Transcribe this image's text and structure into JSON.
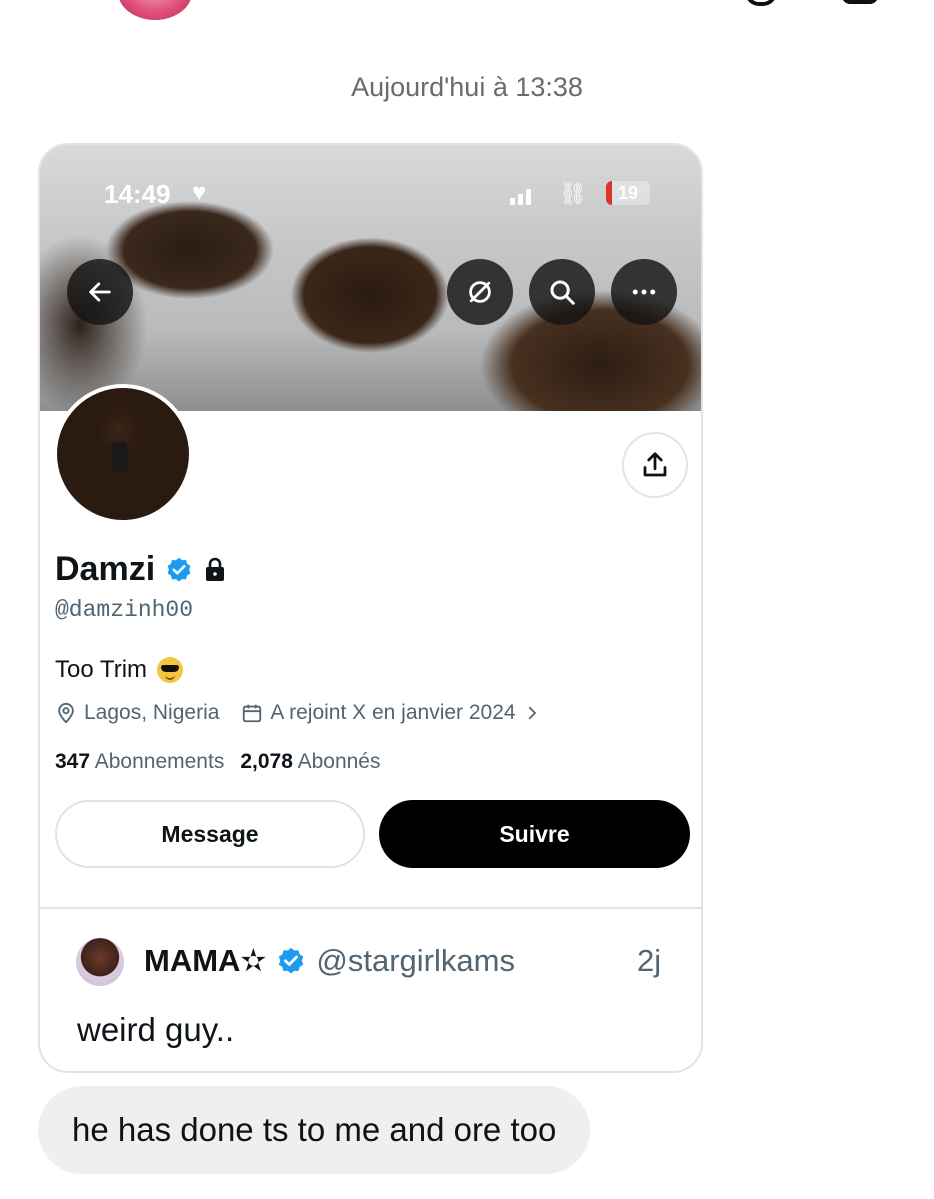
{
  "chat": {
    "timestamp": "Aujourd'hui à 13:38",
    "message_bubble": "he has done ts to me and ore too"
  },
  "profile_card": {
    "status_bar": {
      "time": "14:49",
      "battery": "19"
    },
    "name": "Damzi",
    "handle": "@damzinh00",
    "bio": "Too Trim",
    "location": "Lagos, Nigeria",
    "joined": "A rejoint X en janvier 2024",
    "following_count": "347",
    "following_label": "Abonnements",
    "followers_count": "2,078",
    "followers_label": "Abonnés",
    "message_button": "Message",
    "follow_button": "Suivre"
  },
  "quoted_post": {
    "author_name": "MAMA✫",
    "author_handle": "@stargirlkams",
    "time": "2j",
    "text": "weird guy.."
  },
  "colors": {
    "verified_blue": "#1d9bf0",
    "secondary_text": "#536471",
    "follow_button_bg": "#000000",
    "bubble_bg": "#efefef"
  }
}
